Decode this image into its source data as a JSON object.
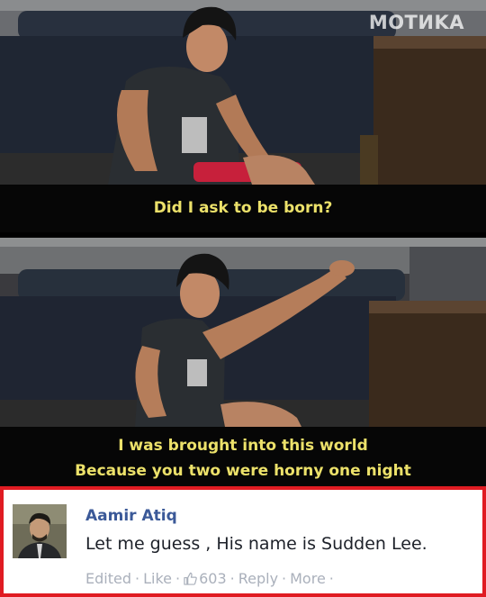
{
  "watermark": "MOTИKA",
  "panels": [
    {
      "caption_lines": [
        "Did I ask to be born?"
      ]
    },
    {
      "caption_lines": [
        "I was brought into this world",
        "Because you two were horny one night"
      ]
    }
  ],
  "comment": {
    "author": "Aamir Atiq",
    "text": "Let me guess , His name is Sudden Lee.",
    "actions": {
      "edited": "Edited",
      "like": "Like",
      "like_count": "603",
      "reply": "Reply",
      "more": "More",
      "separator": "·"
    }
  },
  "colors": {
    "caption": "#ece16a",
    "border": "#e01b22",
    "author": "#3b5998",
    "meta": "#aab0bb"
  }
}
